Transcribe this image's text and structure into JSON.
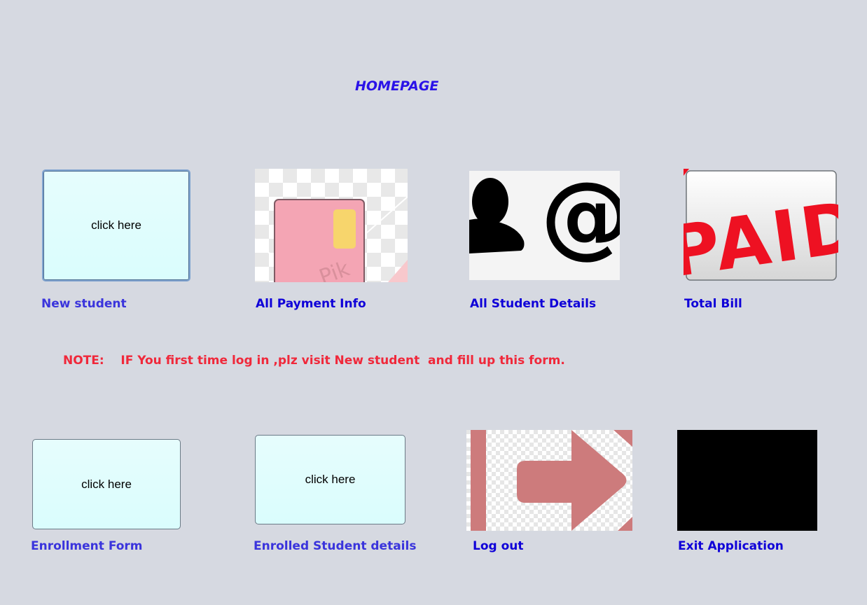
{
  "header": {
    "title": "HOMEPAGE"
  },
  "row1": {
    "new_student": {
      "button_text": "click here",
      "label": "New student"
    },
    "payment_info": {
      "label": "All Payment Info",
      "image_text": "Pik"
    },
    "student_details": {
      "label": "All Student Details",
      "image_text": "@"
    },
    "total_bill": {
      "label": "Total Bill",
      "image_text": "PAID"
    }
  },
  "note": {
    "prefix": "NOTE:",
    "text": "IF You first time log in ,plz visit New student  and fill up this form."
  },
  "row2": {
    "enrollment_form": {
      "button_text": "click here",
      "label": "Enrollment Form"
    },
    "enrolled_details": {
      "button_text": "click here",
      "label": "Enrolled Student details"
    },
    "logout": {
      "label": "Log out"
    },
    "exit": {
      "label": "Exit Application"
    }
  },
  "colors": {
    "title": "#2a12e8",
    "label_light": "#3a34dc",
    "label_dark": "#0f00d8",
    "note": "#f0283a",
    "button_bg": "#dafdfd",
    "logout_arrow": "#cd7b7c",
    "paid_red": "#ee1122"
  },
  "icons": {
    "payment": "credit-card-icon",
    "details": "contact-at-icon",
    "bill": "paid-stamp-icon",
    "logout": "logout-arrow-icon",
    "exit": "exit-black-tile-icon"
  }
}
